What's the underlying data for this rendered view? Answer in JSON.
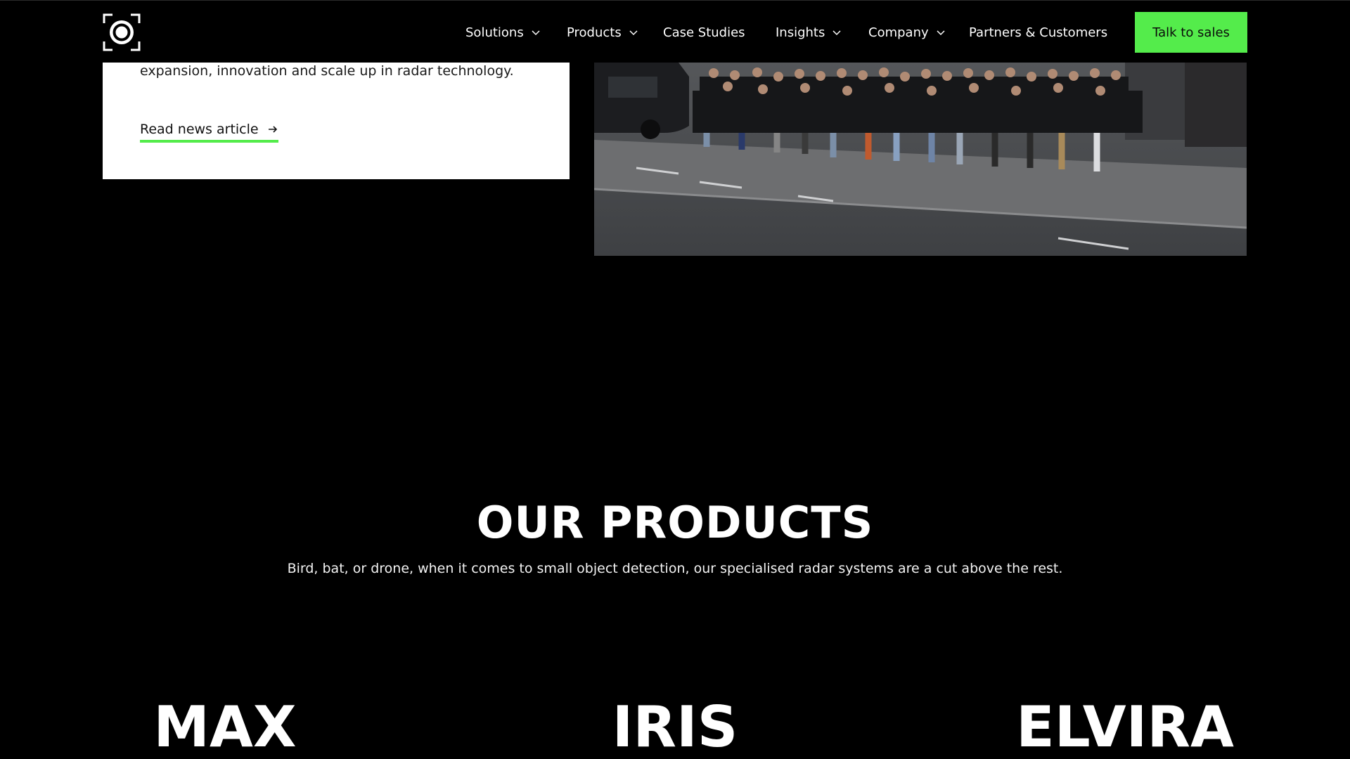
{
  "header": {
    "logo_icon": "radar-ring-logo",
    "nav": [
      {
        "label": "Solutions",
        "has_dropdown": true
      },
      {
        "label": "Products",
        "has_dropdown": true
      },
      {
        "label": "Case Studies",
        "has_dropdown": false
      },
      {
        "label": "Insights",
        "has_dropdown": true
      },
      {
        "label": "Company",
        "has_dropdown": true
      },
      {
        "label": "Partners & Customers",
        "has_dropdown": false
      }
    ],
    "cta_label": "Talk to sales"
  },
  "news": {
    "text": "expansion, innovation and scale up in radar technology.",
    "link_label": "Read news article",
    "link_icon": "arrow-right-icon"
  },
  "products": {
    "title": "OUR PRODUCTS",
    "subtitle": "Bird, bat, or drone, when it comes to small object detection, our specialised radar systems are a cut above the rest.",
    "items": [
      {
        "name": "MAX"
      },
      {
        "name": "IRIS"
      },
      {
        "name": "ELVIRA"
      }
    ]
  },
  "colors": {
    "background": "#000000",
    "accent": "#54ec4b",
    "card": "#ffffff"
  }
}
